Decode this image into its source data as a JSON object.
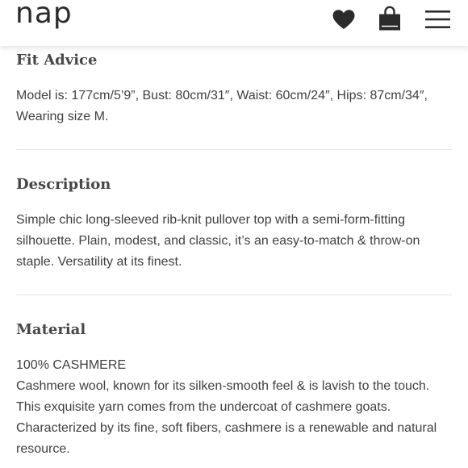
{
  "header": {
    "logo": "nap",
    "icons": [
      "heart-icon",
      "shopping-bag-icon",
      "hamburger-menu-icon"
    ]
  },
  "fit_advice": {
    "title": "Fit Advice",
    "lines": [
      "Model is: 177cm/5’9”, Bust: 80cm/31″, Waist: 60cm/24″, Hips: 87cm/34″,",
      "Wearing size M."
    ]
  },
  "description": {
    "title": "Description",
    "lines": [
      "Simple chic long-sleeved rib-knit pullover top with a semi-form-fitting",
      "silhouette. Plain, modest, and classic, it’s an easy-to-match & throw-on",
      "staple. Versatility at its finest."
    ]
  },
  "material": {
    "title": "Material",
    "lines": [
      "100% CASHMERE",
      "Cashmere wool, known for its silken-smooth feel & is lavish to the touch.",
      "This exquisite yarn comes from the undercoat of cashmere goats.",
      "Characterized by its fine, soft fibers, cashmere is a renewable and natural",
      "resource."
    ]
  },
  "colors": {
    "text": "#404040",
    "heading": "#474747",
    "icon": "#2b2b2b",
    "divider": "#e2e2e2"
  }
}
